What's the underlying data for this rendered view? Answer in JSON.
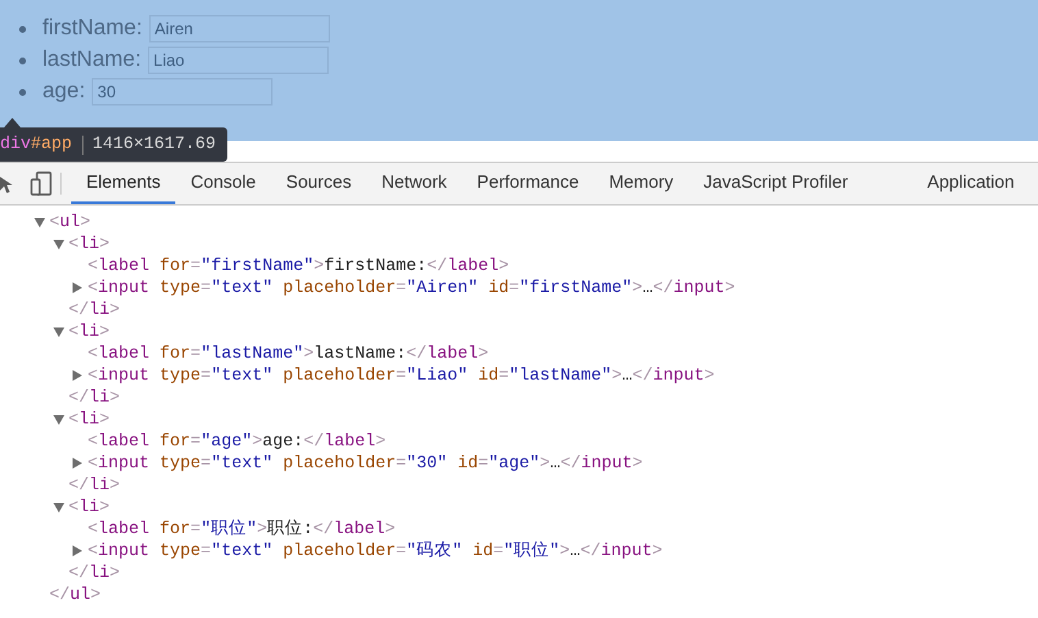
{
  "page_preview": {
    "fields": [
      {
        "label": "firstName:",
        "placeholder": "Airen"
      },
      {
        "label": "lastName:",
        "placeholder": "Liao"
      },
      {
        "label": "age:",
        "placeholder": "30"
      }
    ]
  },
  "inspect_tooltip": {
    "selector": "div#app",
    "size": "1416×1617.69"
  },
  "devtools_tabs": [
    {
      "label": "Elements",
      "selected": true
    },
    {
      "label": "Console",
      "selected": false
    },
    {
      "label": "Sources",
      "selected": false
    },
    {
      "label": "Network",
      "selected": false
    },
    {
      "label": "Performance",
      "selected": false
    },
    {
      "label": "Memory",
      "selected": false
    },
    {
      "label": "JavaScript Profiler",
      "selected": false
    },
    {
      "label": "Application",
      "selected": false
    }
  ],
  "dom_tree": [
    {
      "line": "<ul>",
      "expanded": true,
      "close": "</ul>",
      "children": [
        {
          "line": "<li>",
          "expanded": true,
          "close": "</li>",
          "children": [
            {
              "line": "<label for=\"firstName\">firstName:</label>"
            },
            {
              "line": "<input type=\"text\" placeholder=\"Airen\" id=\"firstName\">…</input>",
              "expanded": false
            }
          ]
        },
        {
          "line": "<li>",
          "expanded": true,
          "close": "</li>",
          "children": [
            {
              "line": "<label for=\"lastName\">lastName:</label>"
            },
            {
              "line": "<input type=\"text\" placeholder=\"Liao\" id=\"lastName\">…</input>",
              "expanded": false
            }
          ]
        },
        {
          "line": "<li>",
          "expanded": true,
          "close": "</li>",
          "children": [
            {
              "line": "<label for=\"age\">age:</label>"
            },
            {
              "line": "<input type=\"text\" placeholder=\"30\" id=\"age\">…</input>",
              "expanded": false
            }
          ]
        },
        {
          "line": "<li>",
          "expanded": true,
          "close": "</li>",
          "children": [
            {
              "line": "<label for=\"职位\">职位:</label>"
            },
            {
              "line": "<input type=\"text\" placeholder=\"码农\" id=\"职位\">…</input>",
              "expanded": false
            }
          ]
        }
      ]
    }
  ]
}
